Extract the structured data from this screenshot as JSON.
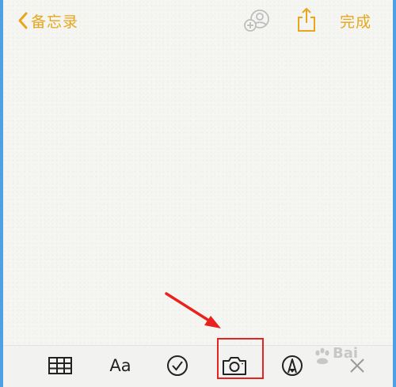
{
  "navbar": {
    "back_label": "备忘录",
    "done_label": "完成"
  },
  "toolbar": {
    "format_label": "Aa",
    "tools": [
      "table-icon",
      "text-format",
      "checklist-icon",
      "camera-icon",
      "markup-pen-icon",
      "close-icon"
    ]
  },
  "annotation": {
    "highlight_color": "#e8221c",
    "highlighted_tool": "camera-icon"
  },
  "watermark": {
    "text": "Bai"
  },
  "colors": {
    "accent": "#e6a71c",
    "background": "#f5f5f2",
    "border": "#4d9fe6"
  }
}
